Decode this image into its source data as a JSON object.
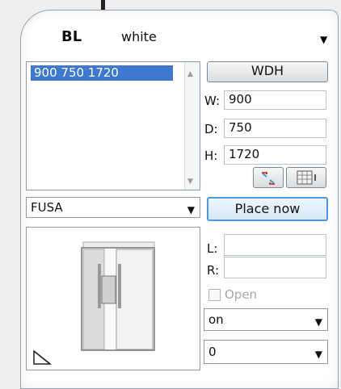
{
  "header": {
    "type_label": "BL",
    "color_value": "white"
  },
  "list": {
    "items": [
      "900  750 1720"
    ]
  },
  "dimensions": {
    "button_label": "WDH",
    "width": {
      "label": "W:",
      "value": "900"
    },
    "depth": {
      "label": "D:",
      "value": "750"
    },
    "height": {
      "label": "H:",
      "value": "1720"
    }
  },
  "series_select": {
    "value": "FUSA"
  },
  "place_button": {
    "label": "Place now"
  },
  "position": {
    "left": {
      "label": "L:",
      "value": ""
    },
    "right": {
      "label": "R:",
      "value": ""
    }
  },
  "open_checkbox": {
    "label": "Open",
    "checked": false
  },
  "on_select": {
    "value": "on"
  },
  "number_select": {
    "value": "0"
  },
  "icons": [
    "expand-arrows-icon",
    "grid-calendar-icon",
    "resize-corner-icon",
    "fridge-preview"
  ],
  "colors": {
    "accent": "#3f78cf",
    "button_border_active": "#4d97df",
    "panel_border": "#9aa3ac"
  }
}
